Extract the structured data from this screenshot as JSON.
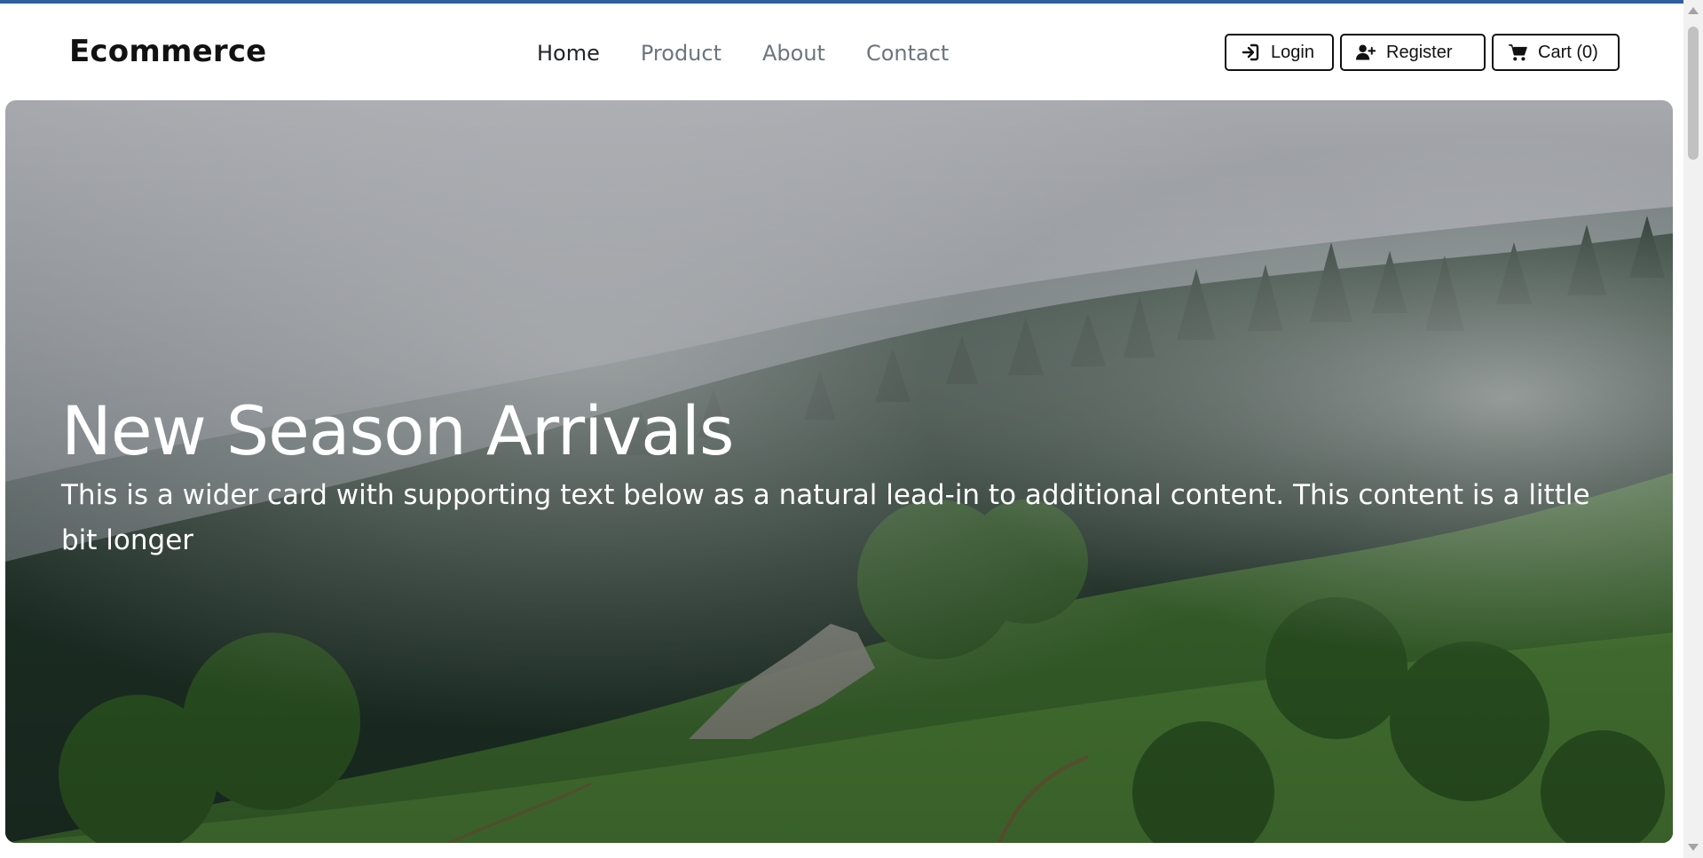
{
  "navbar": {
    "brand": "Ecommerce",
    "links": [
      {
        "label": "Home",
        "active": true
      },
      {
        "label": "Product",
        "active": false
      },
      {
        "label": "About",
        "active": false
      },
      {
        "label": "Contact",
        "active": false
      }
    ],
    "actions": {
      "login_label": "Login",
      "login_icon": "sign-in-icon",
      "register_label": "Register",
      "register_icon": "user-plus-icon",
      "cart_label": "Cart (0)",
      "cart_icon": "shopping-cart-icon"
    }
  },
  "hero": {
    "title": "New Season Arrivals",
    "text": "This is a wider card with supporting text below as a natural lead-in to additional content. This content is a little bit longer",
    "image": "misty-forest-hillside"
  },
  "colors": {
    "accent": "#2f5f9e",
    "text_dark": "#111111",
    "nav_muted": "#6c757d",
    "hero_text": "#ffffff"
  }
}
